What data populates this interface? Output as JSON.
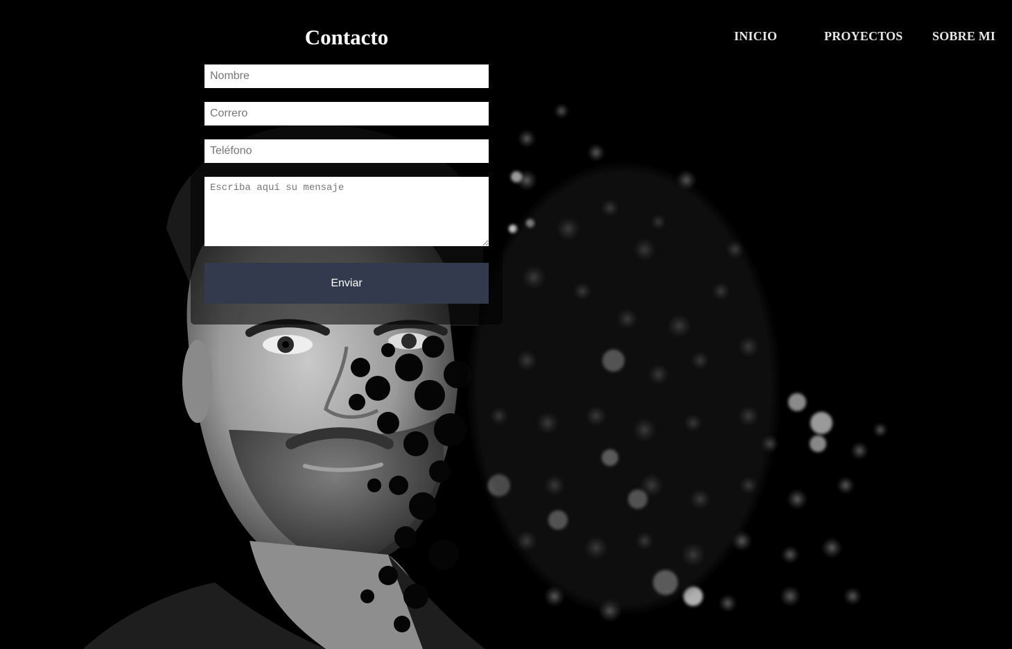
{
  "nav": {
    "items": [
      {
        "label": "INICIO"
      },
      {
        "label": "PROYECTOS"
      },
      {
        "label": "SOBRE MI"
      }
    ]
  },
  "contact": {
    "title": "Contacto",
    "fields": {
      "name_placeholder": "Nombre",
      "email_placeholder": "Correro",
      "phone_placeholder": "Teléfono",
      "message_placeholder": "Escriba aquí su mensaje"
    },
    "submit_label": "Enviar"
  },
  "colors": {
    "background": "#000000",
    "button": "#343a4e",
    "nav_text": "#e6e6e6"
  }
}
